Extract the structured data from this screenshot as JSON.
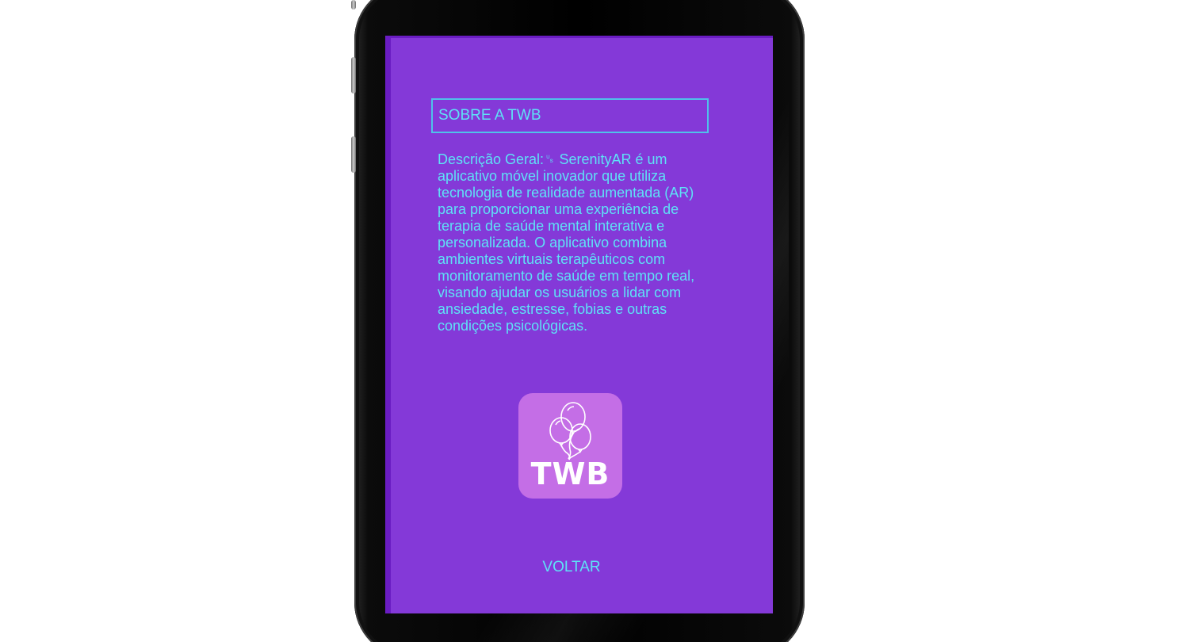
{
  "screen": {
    "title": "SOBRE A TWB",
    "description": "Descrição Geral:␟ SerenityAR é um aplicativo móvel inovador que utiliza tecnologia de realidade aumentada (AR) para proporcionar uma experiência de terapia de saúde mental interativa e personalizada. O aplicativo combina ambientes virtuais terapêuticos com monitoramento de saúde em tempo real, visando ajudar os usuários a lidar com ansiedade, estresse, fobias e outras condições psicológicas.",
    "logo": {
      "text": "TWB",
      "icon": "balloons-icon",
      "background": "#c46ee6"
    },
    "back_label": "VOLTAR"
  },
  "colors": {
    "screen_bg": "#8439d8",
    "text": "#5ee2f6",
    "border": "#4fc1ea",
    "phone": "#000000"
  }
}
